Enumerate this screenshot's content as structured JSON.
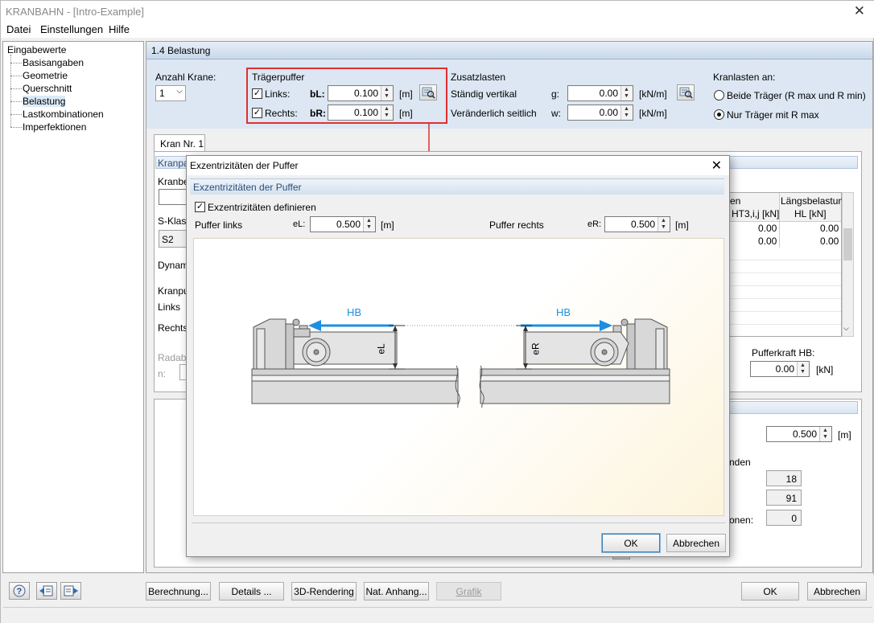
{
  "window": {
    "title": "KRANBAHN - [Intro-Example]",
    "close": "✕"
  },
  "menu": [
    "Datei",
    "Einstellungen",
    "Hilfe"
  ],
  "tree": {
    "root": "Eingabewerte",
    "items": [
      "Basisangaben",
      "Geometrie",
      "Querschnitt",
      "Belastung",
      "Lastkombinationen",
      "Imperfektionen"
    ],
    "selected": "Belastung"
  },
  "section": {
    "title": "1.4  Belastung"
  },
  "cranes": {
    "label": "Anzahl Krane:",
    "value": "1"
  },
  "buffers": {
    "title": "Trägerpuffer",
    "links": {
      "label": "Links:",
      "sym": "bL:",
      "value": "0.100",
      "unit": "[m]"
    },
    "rechts": {
      "label": "Rechts:",
      "sym": "bR:",
      "value": "0.100",
      "unit": "[m]"
    }
  },
  "extra": {
    "title": "Zusatzlasten",
    "vertical": {
      "label": "Ständig vertikal",
      "sym": "g:",
      "value": "0.00",
      "unit": "[kN/m]"
    },
    "lateral": {
      "label": "Veränderlich seitlich",
      "sym": "w:",
      "value": "0.00",
      "unit": "[kN/m]"
    }
  },
  "craneLoads": {
    "title": "Kranlasten an:",
    "opt1": "Beide Träger (R max und R min)",
    "opt2": "Nur Träger mit R max",
    "selected": "opt2"
  },
  "tab": {
    "label": "Kran Nr. 1"
  },
  "bg": {
    "kranpa": "Kranpa",
    "kranbe": "Kranbe",
    "sklass": "S-Klass",
    "s2": "S2",
    "dynam": "Dynam",
    "kranpu": "Kranpu",
    "links": "Links",
    "rechts": "Rechts",
    "radabs": "Radabs",
    "n": "n:",
    "col1": "en",
    "col1sub": "HT3,i,j [kN]",
    "col2": "Längsbelastung",
    "col2sub": "HL [kN]",
    "rows": [
      [
        "0.00",
        "0.00"
      ],
      [
        "0.00",
        "0.00"
      ]
    ],
    "pufferkraft": "Pufferkraft HB:",
    "pufferValue": "0.00",
    "pufferUnit": "[kN]",
    "lowVal": "0.500",
    "lowUnit": "[m]",
    "nden": "nden",
    "v18": "18",
    "v91": "91",
    "onen": "onen:",
    "v0": "0"
  },
  "dialog": {
    "title": "Exzentrizitäten der Puffer",
    "close": "✕",
    "section": "Exzentrizitäten der Puffer",
    "define": "Exzentrizitäten definieren",
    "left": {
      "label": "Puffer links",
      "sym": "eL:",
      "value": "0.500",
      "unit": "[m]"
    },
    "right": {
      "label": "Puffer rechts",
      "sym": "eR:",
      "value": "0.500",
      "unit": "[m]"
    },
    "hbLeft": "HB",
    "hbRight": "HB",
    "eL": "eL",
    "eR": "eR",
    "ok": "OK",
    "cancel": "Abbrechen"
  },
  "bottom": {
    "berechnung": "Berechnung...",
    "details": "Details ...",
    "rendering": "3D-Rendering",
    "anhang": "Nat. Anhang...",
    "grafik": "Grafik",
    "ok": "OK",
    "cancel": "Abbrechen"
  },
  "colors": {
    "accent": "#1e8fe0",
    "highlight": "#e03030"
  }
}
